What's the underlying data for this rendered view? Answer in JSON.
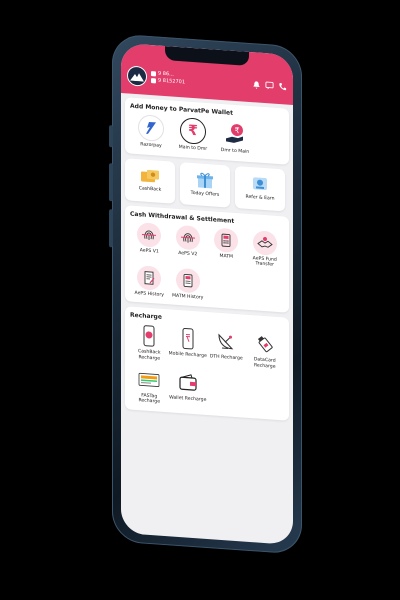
{
  "header": {
    "account_line_1": "9 86...",
    "account_line_2": "9 8152701",
    "brand_color": "#e23d6b"
  },
  "wallet": {
    "title": "Add Money to ParvatPe Wallet",
    "items": [
      {
        "label": "Razorpay",
        "icon": "razorpay-icon"
      },
      {
        "label": "Main to Dmr",
        "icon": "rupee-icon"
      },
      {
        "label": "Dmr to Main",
        "icon": "rupee-hand-icon"
      }
    ]
  },
  "promos": [
    {
      "label": "CashBack",
      "icon": "cashback-icon"
    },
    {
      "label": "Today Offers",
      "icon": "gift-icon"
    },
    {
      "label": "Refer & Earn",
      "icon": "refer-icon"
    }
  ],
  "cash": {
    "title": "Cash Withdrawal & Settlement",
    "items": [
      {
        "label": "AePS V1",
        "icon": "fingerprint-icon"
      },
      {
        "label": "AePS V2",
        "icon": "fingerprint-icon"
      },
      {
        "label": "MATM",
        "icon": "card-terminal-icon"
      },
      {
        "label": "AePS Fund Transfer",
        "icon": "handshake-icon"
      },
      {
        "label": "AePS History",
        "icon": "history-doc-icon"
      },
      {
        "label": "MATM History",
        "icon": "history-terminal-icon"
      }
    ]
  },
  "recharge": {
    "title": "Recharge",
    "items": [
      {
        "label": "CashBack Recharge",
        "icon": "phone-cashback-icon"
      },
      {
        "label": "Mobile Recharge",
        "icon": "mobile-icon"
      },
      {
        "label": "DTH Recharge",
        "icon": "satellite-dish-icon"
      },
      {
        "label": "DataCard Recharge",
        "icon": "usb-datacard-icon"
      },
      {
        "label": "FASTag Recharge",
        "icon": "fastag-icon"
      },
      {
        "label": "Wallet Recharge",
        "icon": "wallet-icon"
      }
    ]
  }
}
